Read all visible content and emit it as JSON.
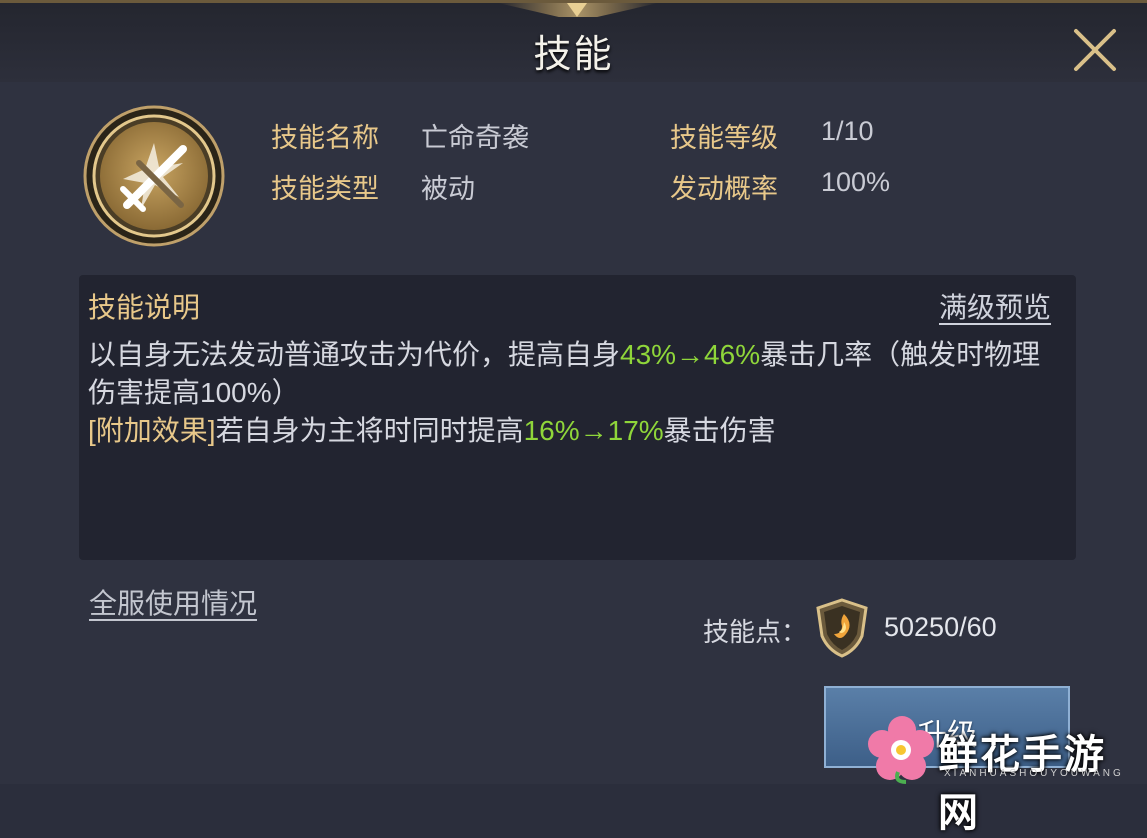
{
  "window": {
    "title": "技能"
  },
  "skill": {
    "name_label": "技能名称",
    "name_value": "亡命奇袭",
    "level_label": "技能等级",
    "level_value": "1/10",
    "type_label": "技能类型",
    "type_value": "被动",
    "rate_label": "发动概率",
    "rate_value": "100%"
  },
  "description": {
    "title": "技能说明",
    "preview_link": "满级预览",
    "line1_prefix": "以自身无法发动普通攻击为代价，提高自身",
    "line1_values": "43%→46%",
    "line1_suffix": "暴击几率（触发时物理伤害提高100%）",
    "effect_tag": "[附加效果]",
    "line2_prefix": "若自身为主将时同时提高",
    "line2_values": "16%→17%",
    "line2_suffix": "暴击伤害"
  },
  "footer": {
    "usage_link": "全服使用情况",
    "points_label": "技能点：",
    "points_value": "50250/60",
    "upgrade_button": "升级"
  },
  "watermark": {
    "text": "鲜花手游网",
    "sub": "XIANHUASHOUYOUWANG"
  },
  "colors": {
    "accent_gold": "#e8c88a",
    "value_green": "#8fd63a",
    "upgrade_blue": "#4a6f98"
  }
}
